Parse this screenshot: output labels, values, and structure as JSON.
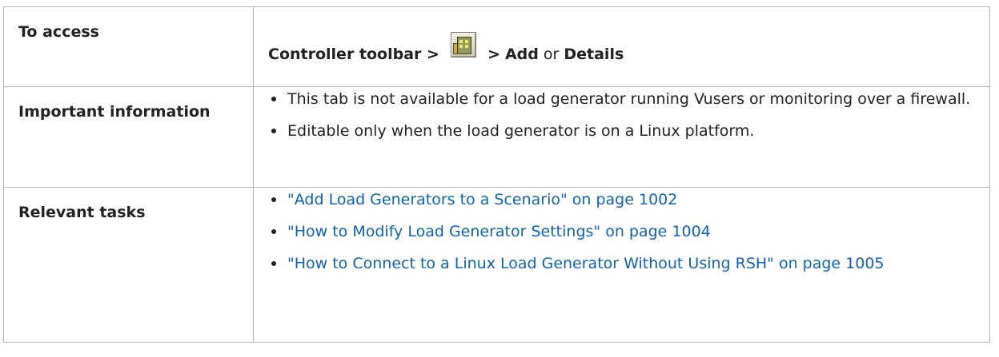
{
  "rows": {
    "access": {
      "label": "To access",
      "prefix": "Controller toolbar >",
      "icon": "load-generators-icon",
      "sep": ">",
      "add": "Add",
      "or": "or",
      "details": "Details"
    },
    "important": {
      "label": "Important information",
      "items": [
        "This tab is not available for a load generator running Vusers or monitoring over a firewall.",
        "Editable only when the load generator is on a Linux platform."
      ]
    },
    "tasks": {
      "label": "Relevant tasks",
      "items": [
        "\"Add Load Generators to a Scenario\" on page 1002",
        "\"How to Modify Load Generator Settings\" on page 1004",
        "\"How to Connect to a Linux Load Generator Without Using RSH\" on page 1005"
      ]
    }
  },
  "colors": {
    "link": "#0f62b4",
    "border": "#b5b5b5",
    "text": "#222222"
  }
}
